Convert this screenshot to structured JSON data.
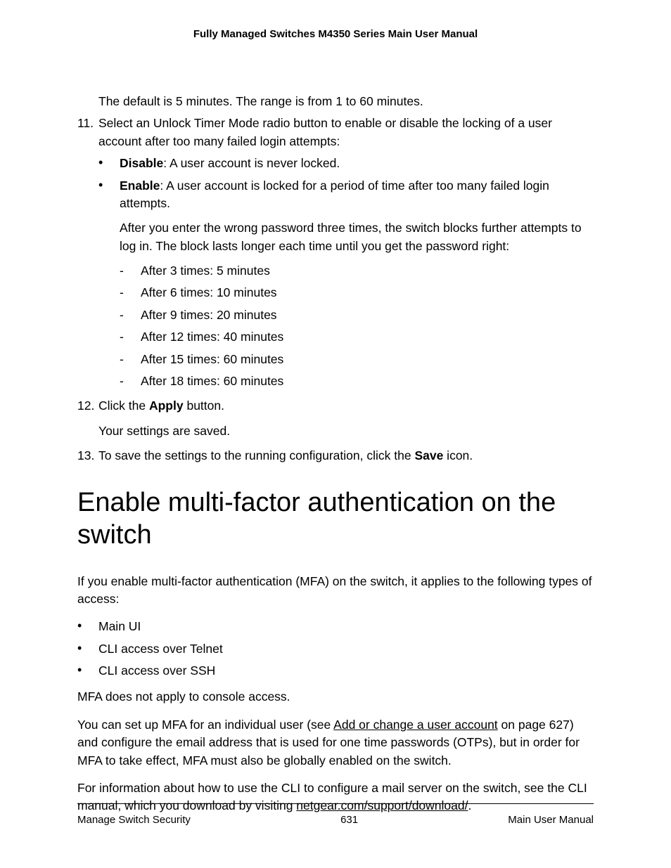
{
  "header": {
    "title": "Fully Managed Switches M4350 Series Main User Manual"
  },
  "content": {
    "intro_line": "The default is 5 minutes. The range is from 1 to 60 minutes.",
    "step11_num": "11.",
    "step11_text": "Select an Unlock Timer Mode radio button to enable or disable the locking of a user account after too many failed login attempts:",
    "disable_label": "Disable",
    "disable_text": ": A user account is never locked.",
    "enable_label": "Enable",
    "enable_text": ": A user account is locked for a period of time after too many failed login attempts.",
    "enable_para": "After you enter the wrong password three times, the switch blocks further attempts to log in. The block lasts longer each time until you get the password right:",
    "times": [
      "After 3 times: 5 minutes",
      "After 6 times: 10 minutes",
      "After 9 times: 20 minutes",
      "After 12 times: 40 minutes",
      "After 15 times: 60 minutes",
      "After 18 times: 60 minutes"
    ],
    "step12_num": "12.",
    "step12_pre": "Click the ",
    "step12_bold": "Apply",
    "step12_post": " button.",
    "step12_result": "Your settings are saved.",
    "step13_num": "13.",
    "step13_pre": "To save the settings to the running configuration, click the ",
    "step13_bold": "Save",
    "step13_post": " icon.",
    "heading": "Enable multi-factor authentication on the switch",
    "mfa_intro": "If you enable multi-factor authentication (MFA) on the switch, it applies to the following types of access:",
    "mfa_bullets": [
      "Main UI",
      "CLI access over Telnet",
      "CLI access over SSH"
    ],
    "mfa_console": "MFA does not apply to console access.",
    "mfa_setup_pre": "You can set up MFA for an individual user (see ",
    "mfa_setup_link": "Add or change a user account",
    "mfa_setup_post": " on page 627) and configure the email address that is used for one time passwords (OTPs), but in order for MFA to take effect, MFA must also be globally enabled on the switch.",
    "mfa_cli_pre": "For information about how to use the CLI to configure a mail server on the switch, see the CLI manual, which you download by visiting ",
    "mfa_cli_link": "netgear.com/support/download/",
    "mfa_cli_post": "."
  },
  "footer": {
    "left": "Manage Switch Security",
    "center": "631",
    "right": "Main User Manual"
  }
}
